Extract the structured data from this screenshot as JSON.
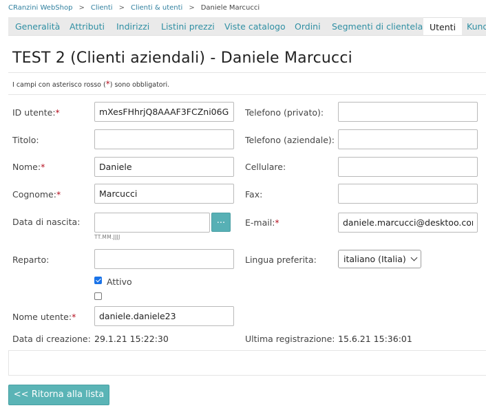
{
  "breadcrumb": {
    "items": [
      "CRanzini WebShop",
      "Clienti",
      "Clienti & utenti"
    ],
    "separator": ">",
    "current": "Daniele Marcucci"
  },
  "tabs": [
    {
      "label": "Generalità"
    },
    {
      "label": "Attributi"
    },
    {
      "label": "Indirizzi"
    },
    {
      "label": "Listini prezzi"
    },
    {
      "label": "Viste catalogo"
    },
    {
      "label": "Ordini"
    },
    {
      "label": "Segmenti di clientela"
    },
    {
      "label": "Utenti",
      "active": true
    },
    {
      "label": "Kund"
    }
  ],
  "page": {
    "title": "TEST 2 (Clienti aziendali) - Daniele Marcucci",
    "required_note_before": "I campi con asterisco rosso (",
    "required_note_star": "*",
    "required_note_after": ") sono obbligatori."
  },
  "form": {
    "required_star": "*",
    "user_id": {
      "label": "ID utente:",
      "value": "mXesFHhrjQ8AAAF3FCZni06G"
    },
    "title": {
      "label": "Titolo:",
      "value": ""
    },
    "first_name": {
      "label": "Nome:",
      "value": "Daniele"
    },
    "last_name": {
      "label": "Cognome:",
      "value": "Marcucci"
    },
    "birth_date": {
      "label": "Data di nascita:",
      "value": "",
      "button_label": "...",
      "format_hint": "TT.MM.JJJJ"
    },
    "department": {
      "label": "Reparto:",
      "value": ""
    },
    "active": {
      "label": "Attivo",
      "checked": true
    },
    "second_checkbox": {
      "checked": false
    },
    "username": {
      "label": "Nome utente:",
      "value": "daniele.daniele23"
    },
    "created": {
      "label": "Data di creazione:",
      "value": "29.1.21 15:22:30"
    },
    "phone_private": {
      "label": "Telefono (privato):",
      "value": ""
    },
    "phone_business": {
      "label": "Telefono (aziendale):",
      "value": ""
    },
    "mobile": {
      "label": "Cellulare:",
      "value": ""
    },
    "fax": {
      "label": "Fax:",
      "value": ""
    },
    "email": {
      "label": "E-mail:",
      "value": "daniele.marcucci@desktoo.com"
    },
    "language": {
      "label": "Lingua preferita:",
      "value": "italiano (Italia)"
    },
    "last_login": {
      "label": "Ultima registrazione:",
      "value": "15.6.21 15:36:01"
    }
  },
  "actions": {
    "back_label": "<< Ritorna alla lista"
  },
  "colors": {
    "link": "#2f7f9e",
    "required": "#b50f1f",
    "button": "#5ab4b6",
    "tab_bar": "#eaeaea",
    "checkbox": "#1a73e8"
  }
}
